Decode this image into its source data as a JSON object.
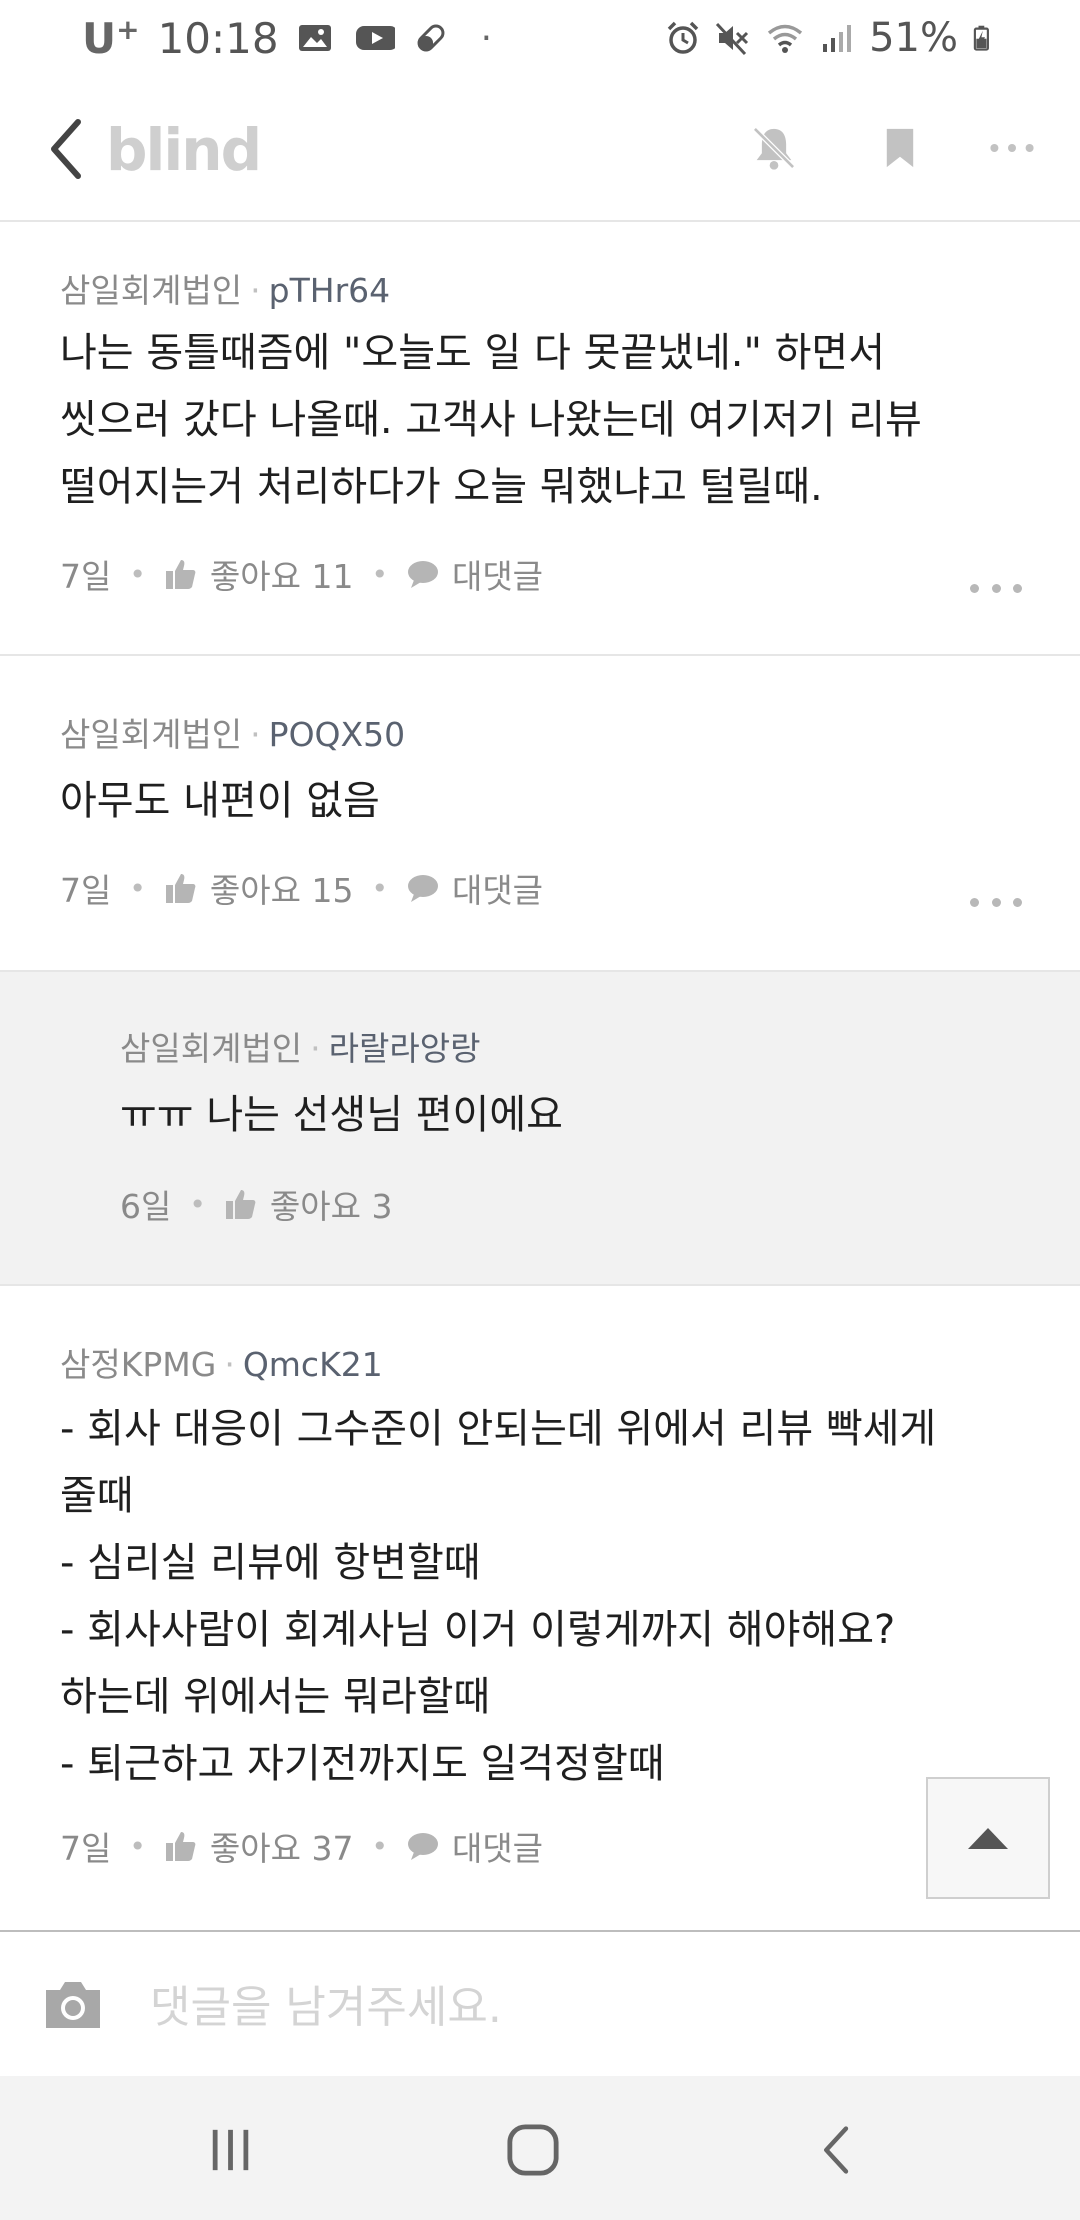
{
  "status_bar": {
    "carrier": "U",
    "carrier_sup": "+",
    "time": "10:18",
    "battery": "51%",
    "dot": "·"
  },
  "header": {
    "brand": "blind",
    "icons": [
      "back-chevron-icon",
      "bell-off-icon",
      "bookmark-icon",
      "more-icon"
    ]
  },
  "comments": [
    {
      "company": "삼일회계법인",
      "nickname": "pTHr64",
      "body": "나는 동틀때즘에 \"오늘도 일 다 못끝냈네.\" 하면서\n씻으러 갔다 나올때. 고객사 나왔는데 여기저기 리뷰\n떨어지는거 처리하다가 오늘 뭐했냐고 털릴때.",
      "time": "7일",
      "likes": "좋아요 11",
      "reply_label": "대댓글"
    },
    {
      "company": "삼일회계법인",
      "nickname": "POQX50",
      "body": "아무도 내편이 없음",
      "time": "7일",
      "likes": "좋아요 15",
      "reply_label": "대댓글"
    },
    {
      "company": "삼일회계법인",
      "nickname": "라랄라앙랑",
      "body": "ㅠㅠ 나는 선생님 편이에요",
      "time": "6일",
      "likes": "좋아요 3"
    },
    {
      "company": "삼정KPMG",
      "nickname": "QmcK21",
      "body": "- 회사 대응이 그수준이 안되는데 위에서 리뷰 빡세게\n줄때\n- 심리실 리뷰에 항변할때\n- 회사사람이 회계사님 이거 이렇게까지 해야해요?\n하는데 위에서는 뭐라할때\n- 퇴근하고 자기전까지도 일걱정할때",
      "time": "7일",
      "likes": "좋아요 37",
      "reply_label": "대댓글"
    }
  ],
  "composer": {
    "placeholder": "댓글을 남겨주세요."
  },
  "colors": {
    "reply_background": "#f2f2f2",
    "divider": "#e6e6e6",
    "brand_text": "#cfcfcf"
  }
}
